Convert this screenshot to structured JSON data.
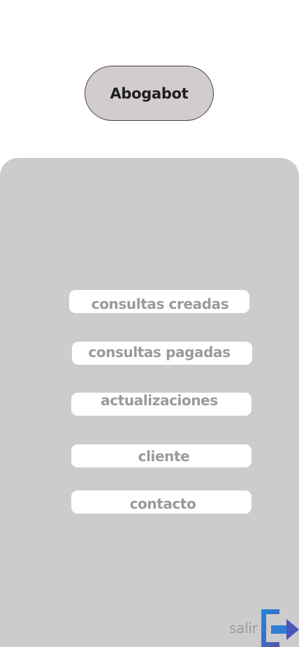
{
  "header": {
    "title": "Abogabot"
  },
  "menu": {
    "items": [
      {
        "label": "consultas creadas"
      },
      {
        "label": "consultas pagadas"
      },
      {
        "label": "actualizaciones"
      },
      {
        "label": "cliente"
      },
      {
        "label": "contacto"
      }
    ]
  },
  "footer": {
    "logout_label": "salir",
    "logout_icon": "logout-icon"
  },
  "colors": {
    "brand_pill": "#d2cccc",
    "panel": "#cccccc",
    "button": "#ffffff",
    "label": "#9a9a9a",
    "icon_blue": "#1e88e5",
    "icon_purple": "#5a4fa6"
  }
}
